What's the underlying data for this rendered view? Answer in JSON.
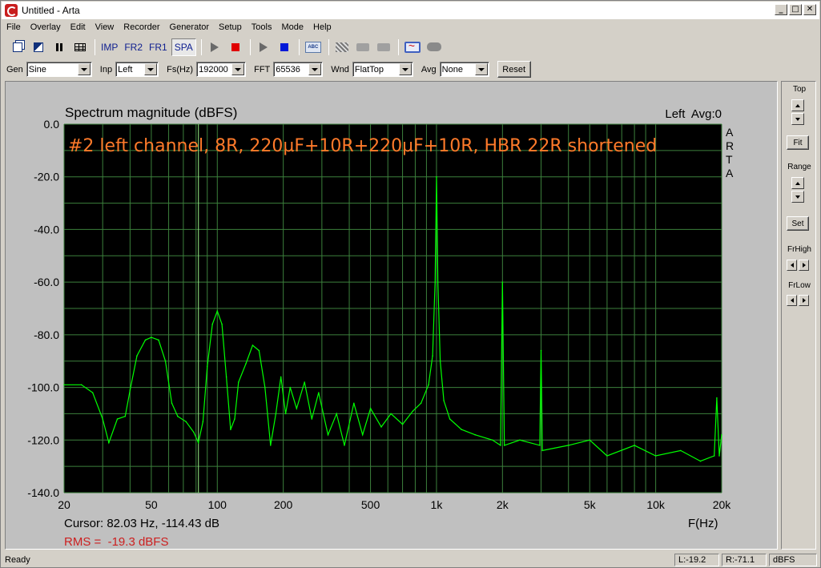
{
  "window": {
    "title": "Untitled - Arta",
    "controls": [
      "_",
      "□",
      "✕"
    ]
  },
  "menu": [
    "File",
    "Overlay",
    "Edit",
    "View",
    "Recorder",
    "Generator",
    "Setup",
    "Tools",
    "Mode",
    "Help"
  ],
  "toolbar": {
    "imp": "IMP",
    "fr2": "FR2",
    "fr1": "FR1",
    "spa": "SPA",
    "abc": "ABC"
  },
  "controls": {
    "gen_label": "Gen",
    "gen_value": "Sine",
    "inp_label": "Inp",
    "inp_value": "Left",
    "fs_label": "Fs(Hz)",
    "fs_value": "192000",
    "fft_label": "FFT",
    "fft_value": "65536",
    "wnd_label": "Wnd",
    "wnd_value": "FlatTop",
    "avg_label": "Avg",
    "avg_value": "None",
    "reset_label": "Reset"
  },
  "plot": {
    "title": "Spectrum magnitude (dBFS)",
    "channel": "Left  Avg:0",
    "annotation": "#2 left channel, 8R, 220µF+10R+220µF+10R, HBR 22R shortened",
    "watermark": [
      "A",
      "R",
      "T",
      "A"
    ],
    "xlabel": "F(Hz)",
    "cursor": "Cursor: 82.03 Hz, -114.43 dB",
    "rms": "RMS =  -19.3 dBFS",
    "colors": {
      "background": "#000000",
      "grid": "#3c803c",
      "trace": "#00ff00",
      "annotation": "#ff7a2a",
      "cursor_line": "#9aef8a",
      "rms": "#cc2020"
    }
  },
  "chart_data": {
    "type": "line",
    "title": "Spectrum magnitude (dBFS)",
    "xlabel": "F(Hz)",
    "ylabel": "",
    "x_scale": "log",
    "xlim": [
      20,
      20000
    ],
    "ylim": [
      -140,
      0
    ],
    "grid": true,
    "x_ticks": [
      {
        "v": 20,
        "label": "20"
      },
      {
        "v": 50,
        "label": "50"
      },
      {
        "v": 100,
        "label": "100"
      },
      {
        "v": 200,
        "label": "200"
      },
      {
        "v": 500,
        "label": "500"
      },
      {
        "v": 1000,
        "label": "1k"
      },
      {
        "v": 2000,
        "label": "2k"
      },
      {
        "v": 5000,
        "label": "5k"
      },
      {
        "v": 10000,
        "label": "10k"
      },
      {
        "v": 20000,
        "label": "20k"
      }
    ],
    "y_ticks": [
      {
        "v": 0,
        "label": "0.0"
      },
      {
        "v": -20,
        "label": "-20.0"
      },
      {
        "v": -40,
        "label": "-40.0"
      },
      {
        "v": -60,
        "label": "-60.0"
      },
      {
        "v": -80,
        "label": "-80.0"
      },
      {
        "v": -100,
        "label": "-100.0"
      },
      {
        "v": -120,
        "label": "-120.0"
      },
      {
        "v": -140,
        "label": "-140.0"
      }
    ],
    "cursor_x": 82.03,
    "series": [
      {
        "values": [
          [
            20,
            -99
          ],
          [
            24,
            -99
          ],
          [
            27,
            -102
          ],
          [
            30,
            -112
          ],
          [
            32,
            -121
          ],
          [
            35,
            -112
          ],
          [
            38,
            -111
          ],
          [
            40,
            -101
          ],
          [
            43,
            -88
          ],
          [
            47,
            -82
          ],
          [
            50,
            -81
          ],
          [
            54,
            -82
          ],
          [
            58,
            -90
          ],
          [
            62,
            -106
          ],
          [
            66,
            -111
          ],
          [
            72,
            -113
          ],
          [
            78,
            -117
          ],
          [
            82,
            -121
          ],
          [
            86,
            -113
          ],
          [
            90,
            -92
          ],
          [
            95,
            -76
          ],
          [
            100,
            -71
          ],
          [
            105,
            -76
          ],
          [
            110,
            -96
          ],
          [
            115,
            -116
          ],
          [
            120,
            -112
          ],
          [
            125,
            -98
          ],
          [
            135,
            -91
          ],
          [
            145,
            -84
          ],
          [
            155,
            -86
          ],
          [
            165,
            -100
          ],
          [
            175,
            -122
          ],
          [
            185,
            -110
          ],
          [
            195,
            -96
          ],
          [
            205,
            -110
          ],
          [
            215,
            -100
          ],
          [
            230,
            -108
          ],
          [
            250,
            -98
          ],
          [
            270,
            -112
          ],
          [
            290,
            -102
          ],
          [
            320,
            -118
          ],
          [
            350,
            -110
          ],
          [
            380,
            -122
          ],
          [
            420,
            -106
          ],
          [
            460,
            -118
          ],
          [
            500,
            -108
          ],
          [
            560,
            -115
          ],
          [
            620,
            -110
          ],
          [
            700,
            -114
          ],
          [
            780,
            -109
          ],
          [
            850,
            -106
          ],
          [
            920,
            -99
          ],
          [
            960,
            -88
          ],
          [
            985,
            -60
          ],
          [
            1000,
            -20
          ],
          [
            1015,
            -60
          ],
          [
            1040,
            -90
          ],
          [
            1080,
            -105
          ],
          [
            1150,
            -112
          ],
          [
            1300,
            -116
          ],
          [
            1500,
            -118
          ],
          [
            1800,
            -120
          ],
          [
            1960,
            -122
          ],
          [
            2000,
            -60
          ],
          [
            2040,
            -122
          ],
          [
            2400,
            -120
          ],
          [
            2960,
            -122
          ],
          [
            3000,
            -86
          ],
          [
            3040,
            -124
          ],
          [
            4000,
            -122
          ],
          [
            5000,
            -120
          ],
          [
            6000,
            -126
          ],
          [
            8000,
            -122
          ],
          [
            10000,
            -126
          ],
          [
            13000,
            -124
          ],
          [
            16000,
            -128
          ],
          [
            18500,
            -126
          ],
          [
            19000,
            -104
          ],
          [
            19500,
            -126
          ],
          [
            20000,
            -118
          ]
        ]
      }
    ]
  },
  "right_panel": {
    "top": "Top",
    "fit": "Fit",
    "range": "Range",
    "set": "Set",
    "frhigh": "FrHigh",
    "frlow": "FrLow"
  },
  "status": {
    "text": "Ready",
    "l": "L:-19.2",
    "r": "R:-71.1",
    "unit": "dBFS"
  }
}
